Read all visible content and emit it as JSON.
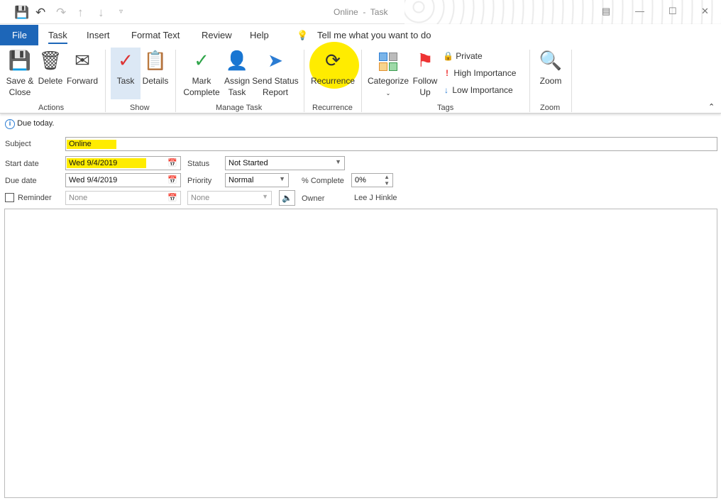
{
  "window": {
    "title": "Online  -  Task"
  },
  "quick_access": {
    "save": "save-icon",
    "undo": "undo-icon",
    "redo": "redo-icon",
    "up": "up-arrow-icon",
    "down": "down-arrow-icon",
    "customize": "customize-icon"
  },
  "tabs": {
    "file": "File",
    "task": "Task",
    "insert": "Insert",
    "format_text": "Format Text",
    "review": "Review",
    "help": "Help",
    "tell_me": "Tell me what you want to do"
  },
  "ribbon": {
    "actions": {
      "label": "Actions",
      "save_close": "Save &\nClose",
      "delete": "Delete",
      "forward": "Forward"
    },
    "show": {
      "label": "Show",
      "task": "Task",
      "details": "Details"
    },
    "manage": {
      "label": "Manage Task",
      "mark_complete": "Mark\nComplete",
      "assign_task": "Assign\nTask",
      "send_status": "Send Status\nReport"
    },
    "recurrence": {
      "label": "Recurrence",
      "button": "Recurrence"
    },
    "tags": {
      "label": "Tags",
      "categorize": "Categorize",
      "follow_up": "Follow\nUp",
      "private": "Private",
      "high": "High Importance",
      "low": "Low Importance"
    },
    "zoom": {
      "label": "Zoom",
      "button": "Zoom"
    }
  },
  "highlight_color": "#ffec00",
  "info": "Due today.",
  "form": {
    "subject_label": "Subject",
    "subject": "Online",
    "start_label": "Start date",
    "start": "Wed 9/4/2019",
    "due_label": "Due date",
    "due": "Wed 9/4/2019",
    "status_label": "Status",
    "status": "Not Started",
    "priority_label": "Priority",
    "priority": "Normal",
    "complete_label": "% Complete",
    "complete": "0%",
    "reminder_label": "Reminder",
    "reminder_date": "None",
    "reminder_time": "None",
    "owner_label": "Owner",
    "owner": "Lee J Hinkle"
  }
}
